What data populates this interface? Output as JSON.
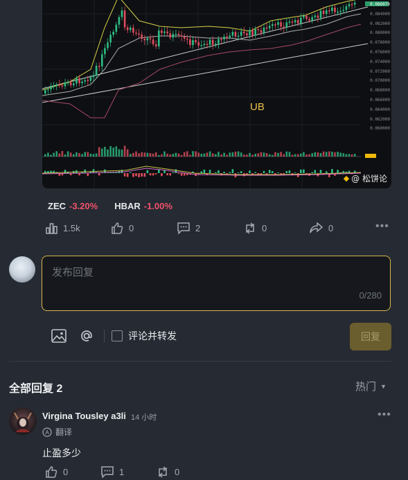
{
  "chart": {
    "annotation": "UB",
    "watermark": "@ 松饼论",
    "price_ticks": [
      "0.086070",
      "0.084000",
      "0.082000",
      "0.080000",
      "0.078000",
      "0.076000",
      "0.074000",
      "0.072000",
      "0.070000",
      "0.068000",
      "0.066000",
      "0.064000",
      "0.062000",
      "0.060000"
    ]
  },
  "tickers": [
    {
      "symbol": "ZEC",
      "change": "-3.20%"
    },
    {
      "symbol": "HBAR",
      "change": "-1.00%"
    }
  ],
  "post_actions": {
    "views": "1.5k",
    "likes": "0",
    "comments": "2",
    "reposts": "0",
    "shares": "0"
  },
  "reply": {
    "placeholder": "发布回复",
    "counter": "0/280",
    "repost_checkbox_label": "评论并转发",
    "submit_label": "回复"
  },
  "comments_section": {
    "title": "全部回复 2",
    "sort_label": "热门"
  },
  "comment": {
    "author": "Virgina Tousley a3li",
    "time": "14 小时",
    "translate_label": "翻译",
    "text": "止盈多少",
    "likes": "0",
    "replies": "1",
    "reposts": "0"
  },
  "colors": {
    "accent": "#d9b74a",
    "negative": "#f0516a",
    "background": "#262b33"
  }
}
